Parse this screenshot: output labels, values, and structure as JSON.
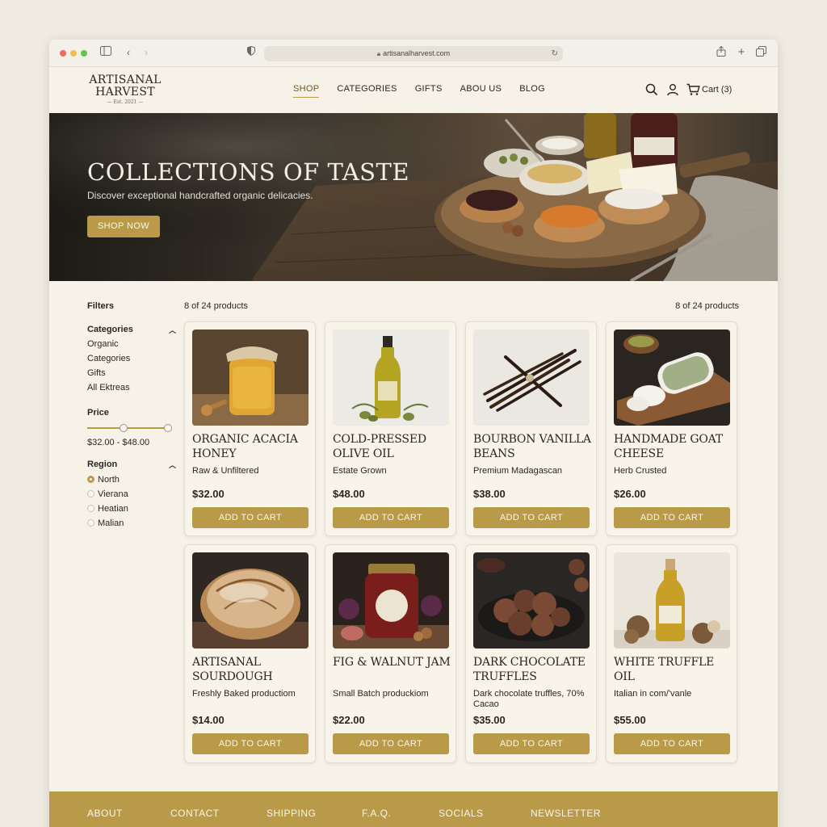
{
  "browser": {
    "url": "artisanalharvest.com"
  },
  "header": {
    "logo_line1": "ARTISANAL",
    "logo_line2": "HARVEST",
    "logo_line3": "— Est. 2021 —",
    "nav": [
      "SHOP",
      "CATEGORIES",
      "GIFTS",
      "ABOU US",
      "BLOG"
    ],
    "active_nav": "SHOP",
    "cart_label": "Cart (3)"
  },
  "hero": {
    "title": "COLLECTIONS OF TASTE",
    "subtitle": "Discover exceptional handcrafted organic delicacies.",
    "button": "SHOP NOW"
  },
  "filters": {
    "title": "Filters",
    "categories_label": "Categories",
    "categories": [
      "Organic",
      "Categories",
      "Gifts",
      "All Ektreas"
    ],
    "price_label": "Price",
    "price_range": "$32.00 - $48.00",
    "region_label": "Region",
    "regions": [
      {
        "label": "North",
        "selected": true
      },
      {
        "label": "Vierana",
        "selected": false
      },
      {
        "label": "Heatian",
        "selected": false
      },
      {
        "label": "Malian",
        "selected": false
      }
    ]
  },
  "results": {
    "count_left": "8 of 24 products",
    "count_right": "8 of 24 products"
  },
  "products": [
    {
      "name": "ORGANIC ACACIA HONEY",
      "desc": "Raw & Unfiltered",
      "price": "$32.00",
      "button": "ADD TO CART",
      "icon": "honey-jar"
    },
    {
      "name": "COLD-PRESSED OLIVE OIL",
      "desc": "Estate Grown",
      "price": "$48.00",
      "button": "ADD TO CART",
      "icon": "olive-oil-bottle"
    },
    {
      "name": "BOURBON VANILLA BEANS",
      "desc": "Premium Madagascan",
      "price": "$38.00",
      "button": "ADD TO CART",
      "icon": "vanilla-beans"
    },
    {
      "name": "HANDMADE GOAT CHEESE",
      "desc": "Herb Crusted",
      "price": "$26.00",
      "button": "ADD TO CART",
      "icon": "goat-cheese"
    },
    {
      "name": "ARTISANAL SOURDOUGH",
      "desc": "Freshly Baked productiom",
      "price": "$14.00",
      "button": "ADD TO CART",
      "icon": "sourdough-loaf"
    },
    {
      "name": "FIG & WALNUT JAM",
      "desc": "Small Batch produckiom",
      "price": "$22.00",
      "button": "ADD TO CART",
      "icon": "jam-jar"
    },
    {
      "name": "DARK CHOCOLATE TRUFFLES",
      "desc": "Dark chocolate truffles, 70% Cacao",
      "price": "$35.00",
      "button": "ADD TO CART",
      "icon": "truffles"
    },
    {
      "name": "WHITE TRUFFLE OIL",
      "desc": "Italian in com/'vanle",
      "price": "$55.00",
      "button": "ADD TO CART",
      "icon": "truffle-oil"
    }
  ],
  "footer": [
    "ABOUT",
    "CONTACT",
    "SHIPPING",
    "F.A.Q.",
    "SOCIALS",
    "NEWSLETTER"
  ]
}
